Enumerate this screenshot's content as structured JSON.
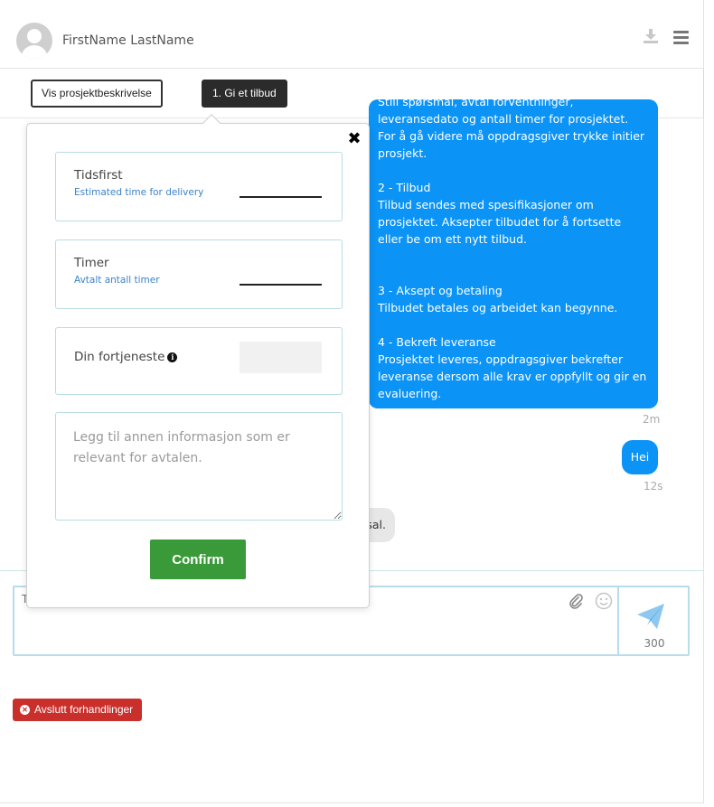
{
  "header": {
    "user_name": "FirstName LastName",
    "download_icon": "download-icon",
    "menu_icon": "hamburger-menu-icon"
  },
  "toolbar": {
    "project_description_label": "Vis prosjektbeskrivelse",
    "offer_label": "1. Gi et tilbud"
  },
  "chat": {
    "info_message": "Still spørsmål, avtal forventninger, leveransedato og antall timer for prosjektet. For å gå videre må oppdragsgiver trykke initier prosjekt.\n\n2 - Tilbud\nTilbud sendes med spesifikasjoner om prosjektet. Aksepter tilbudet for å fortsette eller be om ett nytt tilbud.\n\n\n3 - Aksept og betaling\nTilbudet betales og arbeidet kan begynne.\n\n4 - Bekreft leveranse\nProsjektet leveres, oppdragsgiver bekrefter leveranse dersom alle krav er oppfyllt og gir en evaluering.",
    "info_timestamp": "2m",
    "hei_message": "Hei",
    "hei_timestamp": "12s",
    "grey_message": "sal."
  },
  "composer": {
    "placeholder": "Type your message...",
    "attach_icon": "paperclip-icon",
    "emoji_icon": "smiley-icon",
    "send_icon": "paper-plane-icon",
    "char_count": "300"
  },
  "end_negotiation_label": "Avslutt forhandlinger",
  "offer_form": {
    "close_icon": "close-icon",
    "deadline": {
      "label": "Tidsfirst",
      "sub": "Estimated time for delivery",
      "value": ""
    },
    "hours": {
      "label": "Timer",
      "sub": "Avtalt antall timer",
      "value": ""
    },
    "profit": {
      "label": "Din fortjeneste",
      "info_icon": "info-icon",
      "value": ""
    },
    "notes_placeholder": "Legg til annen informasjon som er relevant for avtalen.",
    "confirm_label": "Confirm"
  },
  "colors": {
    "chat_blue": "#0b93f6",
    "confirm_green": "#3a9a3a",
    "danger_red": "#c9302c",
    "border_teal": "#b9dce3"
  }
}
